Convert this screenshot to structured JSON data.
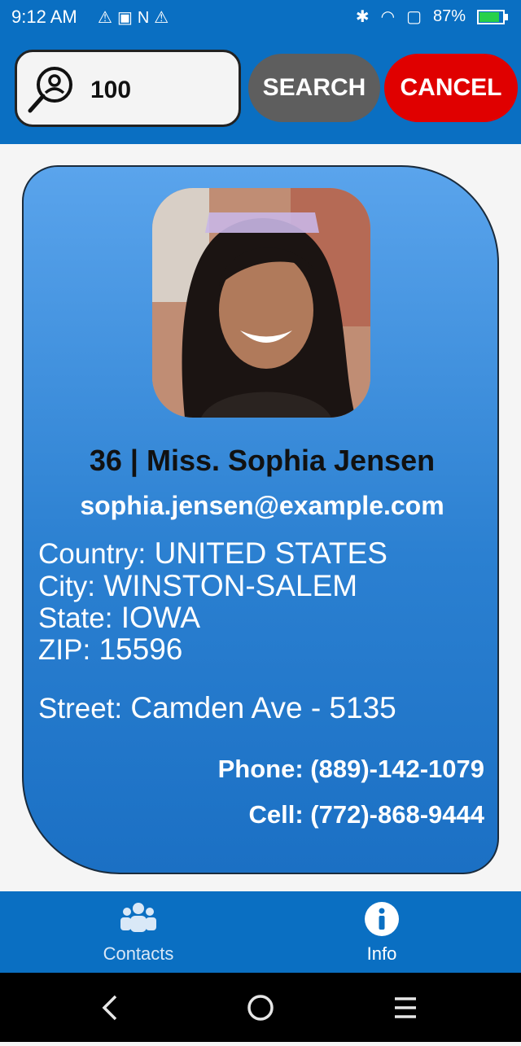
{
  "status_bar": {
    "time": "9:12 AM",
    "battery": "87%"
  },
  "search": {
    "value": "100",
    "search_label": "SEARCH",
    "cancel_label": "CANCEL"
  },
  "profile": {
    "name_line": "36 | Miss. Sophia Jensen",
    "email": "sophia.jensen@example.com",
    "country_label": "Country:",
    "country": "UNITED STATES",
    "city_label": "City:",
    "city": "WINSTON-SALEM",
    "state_label": "State:",
    "state": "IOWA",
    "zip_label": "ZIP:",
    "zip": "15596",
    "street_label": "Street:",
    "street": "Camden Ave - 5135",
    "phone": "Phone: (889)-142-1079",
    "cell": "Cell: (772)-868-9444"
  },
  "bottom_nav": [
    {
      "label": "Contacts",
      "icon": "contacts-icon"
    },
    {
      "label": "Info",
      "icon": "info-icon"
    }
  ],
  "colors": {
    "primary": "#0a6fc2",
    "cancel": "#e00000",
    "search_button": "#5e5e5e"
  }
}
